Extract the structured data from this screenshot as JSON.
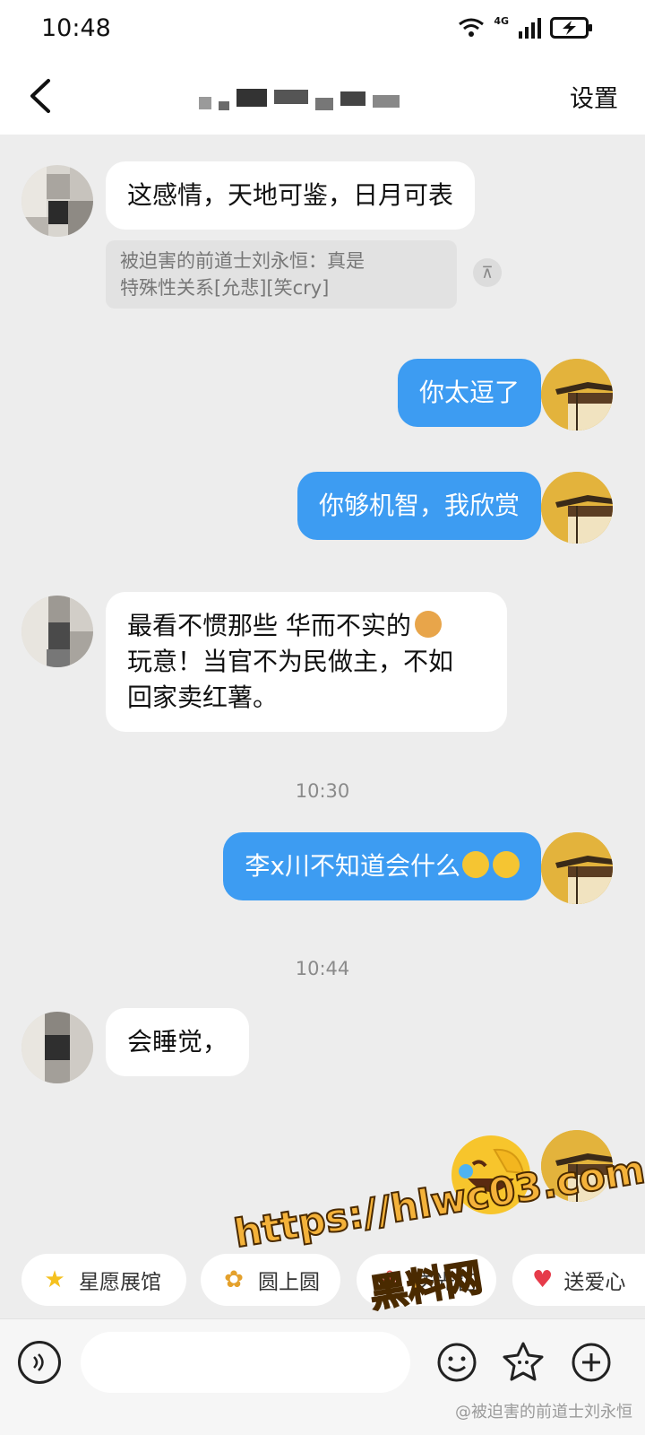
{
  "status_bar": {
    "time": "10:48",
    "network": "4G"
  },
  "header": {
    "title_redacted": "",
    "settings_label": "设置"
  },
  "messages": [
    {
      "side": "in",
      "text": "这感情，天地可鉴，日月可表"
    },
    {
      "side": "out",
      "text": "你太逗了"
    },
    {
      "side": "out",
      "text": "你够机智，我欣赏"
    },
    {
      "side": "in",
      "line1": "最看不惯那些 华而不实的",
      "line2": "玩意！当官不为民做主，不如",
      "line3": "回家卖红薯。"
    },
    {
      "side": "out",
      "text": "李x川不知道会什么"
    },
    {
      "side": "in",
      "text": "会睡觉，"
    }
  ],
  "quote": {
    "line1": "被迫害的前道士刘永恒：真是",
    "line2": "特殊性关系[允悲][笑cry]",
    "collapse_glyph": "⊼"
  },
  "timestamps": [
    "10:30",
    "10:44"
  ],
  "shortcuts": [
    {
      "label": "星愿展馆",
      "icon": "star-icon"
    },
    {
      "label": "圆上圆",
      "icon": "paw-icon"
    },
    {
      "label": "送光花",
      "icon": "flower-icon"
    },
    {
      "label": "送爱心",
      "icon": "heart-icon"
    }
  ],
  "input": {
    "placeholder": ""
  },
  "watermark": {
    "url": "https://hlwc03.com",
    "site": "黑料网",
    "weibo": "@被迫害的前道士刘永恒"
  },
  "colors": {
    "bubble_out": "#3d9cf2",
    "bubble_in": "#ffffff",
    "background": "#ededed",
    "avatar_me": "#e3b33c"
  }
}
